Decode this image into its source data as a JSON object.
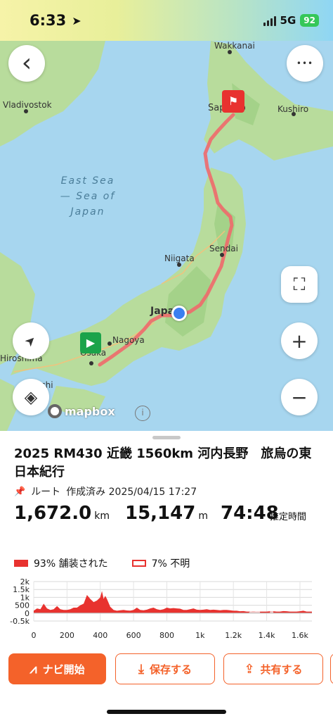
{
  "status_bar": {
    "time": "6:33",
    "network": "5G",
    "battery": "92",
    "location_icon": "location-arrow-icon"
  },
  "map": {
    "labels": {
      "wakkanai": "Wakkanai",
      "sapporo": "Sapporo",
      "kushiro": "Kushiro",
      "vladivostok": "Vladivostok",
      "niigata": "Niigata",
      "sendai": "Sendai",
      "japan": "Japan",
      "nagoya": "Nagoya",
      "osaka": "Osaka",
      "hiroshima": "Hiroshima",
      "chi": "chi"
    },
    "sea_label": "East Sea — Sea of Japan",
    "sea_lines": [
      "East Sea",
      "— Sea of",
      "Japan"
    ],
    "attribution": "mapbox",
    "info_glyph": "i",
    "colors": {
      "water": "#a7d6ef",
      "land": "#b8dc9c",
      "route": "#f0696b"
    },
    "controls": {
      "back_icon": "‹",
      "more_icon": "•••",
      "fullscreen_icon": "⛶",
      "zoom_in_icon": "+",
      "zoom_out_icon": "−",
      "locate_icon": "➤",
      "layers_icon": "◈"
    }
  },
  "route": {
    "title": "2025 RM430 近畿 1560km 河内長野　旅烏の東日本紀行",
    "type_label": "ルート",
    "created_label": "作成済み 2025/04/15 17:27",
    "distance_value": "1,672.0",
    "distance_unit": "km",
    "elevation_value": "15,147",
    "elevation_unit": "m",
    "time_value": "74:48",
    "time_label": "推定時間"
  },
  "legend": {
    "paved": "93% 舗装された",
    "unknown": "7% 不明"
  },
  "chart_data": {
    "type": "area",
    "title": "",
    "xlabel": "",
    "ylabel": "",
    "x_tick_labels": [
      "0",
      "200",
      "400",
      "600",
      "800",
      "1k",
      "1.2k",
      "1.4k",
      "1.6k"
    ],
    "y_tick_labels": [
      "2k",
      "1.5k",
      "1k",
      "500",
      "0",
      "-0.5k"
    ],
    "xlim": [
      0,
      1672
    ],
    "ylim": [
      -500,
      2000
    ],
    "grid": true,
    "series": [
      {
        "name": "",
        "x": [
          0,
          20,
          40,
          60,
          80,
          100,
          120,
          140,
          160,
          180,
          200,
          220,
          240,
          260,
          280,
          300,
          320,
          340,
          360,
          380,
          400,
          410,
          420,
          430,
          440,
          450,
          460,
          480,
          500,
          520,
          540,
          560,
          580,
          600,
          620,
          640,
          660,
          680,
          700,
          720,
          740,
          760,
          780,
          800,
          820,
          840,
          860,
          880,
          900,
          920,
          940,
          960,
          980,
          1000,
          1020,
          1040,
          1060,
          1080,
          1100,
          1120,
          1140,
          1160,
          1180,
          1200,
          1220,
          1240,
          1260,
          1280,
          1300,
          1320,
          1340,
          1360,
          1380,
          1400,
          1420,
          1440,
          1460,
          1480,
          1500,
          1520,
          1540,
          1560,
          1580,
          1600,
          1620,
          1640,
          1672
        ],
        "values": [
          150,
          300,
          250,
          600,
          300,
          200,
          250,
          450,
          250,
          200,
          200,
          250,
          350,
          350,
          500,
          600,
          1150,
          900,
          700,
          800,
          1000,
          1400,
          900,
          1100,
          900,
          650,
          400,
          200,
          150,
          180,
          200,
          170,
          160,
          200,
          350,
          200,
          180,
          220,
          300,
          350,
          250,
          200,
          250,
          350,
          300,
          320,
          300,
          280,
          200,
          200,
          250,
          300,
          220,
          200,
          220,
          250,
          200,
          220,
          200,
          180,
          200,
          200,
          180,
          150,
          150,
          120,
          130,
          100,
          100,
          120,
          100,
          100,
          100,
          100,
          120,
          120,
          100,
          100,
          130,
          120,
          100,
          100,
          100,
          120,
          150,
          100,
          100
        ]
      }
    ],
    "unknown_segments": [
      [
        1290,
        1360
      ],
      [
        1420,
        1440
      ]
    ],
    "colors": {
      "paved": "#e8322f",
      "unknown": "#f7c9c9"
    }
  },
  "actions": {
    "navigate": "ナビ開始",
    "save": "保存する",
    "share": "共有する"
  }
}
